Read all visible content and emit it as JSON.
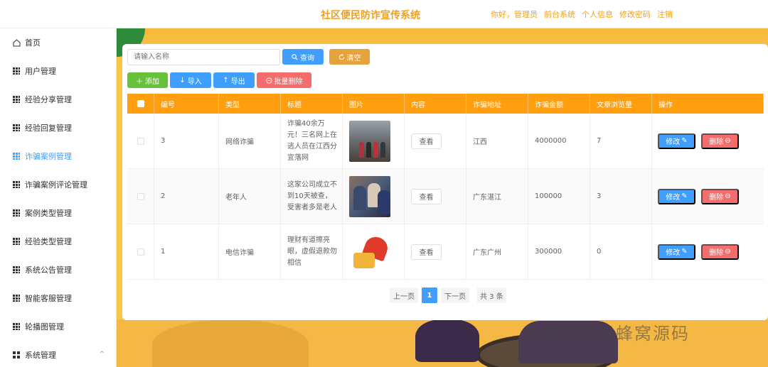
{
  "header": {
    "title": "社区便民防诈宣传系统",
    "nav": [
      "你好，管理员",
      "前台系统",
      "个人信息",
      "修改密码",
      "注销"
    ]
  },
  "sidebar": {
    "items": [
      {
        "label": "首页",
        "icon": "home-icon"
      },
      {
        "label": "用户管理",
        "icon": "grid-icon"
      },
      {
        "label": "经验分享管理",
        "icon": "grid-icon"
      },
      {
        "label": "经验回复管理",
        "icon": "grid-icon"
      },
      {
        "label": "诈骗案例管理",
        "icon": "grid-icon",
        "active": true
      },
      {
        "label": "诈骗案例评论管理",
        "icon": "grid-icon"
      },
      {
        "label": "案例类型管理",
        "icon": "grid-icon"
      },
      {
        "label": "经验类型管理",
        "icon": "grid-icon"
      },
      {
        "label": "系统公告管理",
        "icon": "grid-icon"
      },
      {
        "label": "智能客服管理",
        "icon": "grid-icon"
      },
      {
        "label": "轮播图管理",
        "icon": "grid-icon"
      },
      {
        "label": "系统管理",
        "icon": "apps-icon",
        "chevron": "^"
      }
    ]
  },
  "toolbar": {
    "search_placeholder": "请输入名称",
    "query_label": "查询",
    "clear_label": "清空",
    "add_label": "添加",
    "import_label": "导入",
    "export_label": "导出",
    "batch_delete_label": "批量删除"
  },
  "table": {
    "columns": [
      "编号",
      "类型",
      "标题",
      "图片",
      "内容",
      "诈骗地址",
      "诈骗金额",
      "文章浏览量",
      "操作"
    ],
    "rows": [
      {
        "id": "3",
        "type": "网络诈骗",
        "title": "诈骗40余万元！三名网上在逃人员在江西分宜落网",
        "image": "photo-thumbnail",
        "content": "查看",
        "address": "江西",
        "amount": "4000000",
        "views": "7"
      },
      {
        "id": "2",
        "type": "老年人",
        "title": "这家公司成立不到10天被查，受害者多是老人",
        "image": "photo-thumbnail",
        "content": "查看",
        "address": "广东湛江",
        "amount": "100000",
        "views": "3"
      },
      {
        "id": "1",
        "type": "电信诈骗",
        "title": "理财有道擦亮眼，虚假退款勿相信",
        "image": "illustration-thumbnail",
        "content": "查看",
        "address": "广东广州",
        "amount": "300000",
        "views": "0"
      }
    ],
    "edit_label": "修改",
    "delete_label": "删除"
  },
  "pagination": {
    "prev": "上一页",
    "current": "1",
    "next": "下一页",
    "total": "共 3 条"
  },
  "background": {
    "watermark": "公众号・码蜂窝源码"
  },
  "colors": {
    "accent": "#409eff",
    "header_title": "#f0a020",
    "table_head": "#ff9f10",
    "success": "#67c23a",
    "warning": "#e6a23c",
    "danger": "#f56c6c"
  }
}
